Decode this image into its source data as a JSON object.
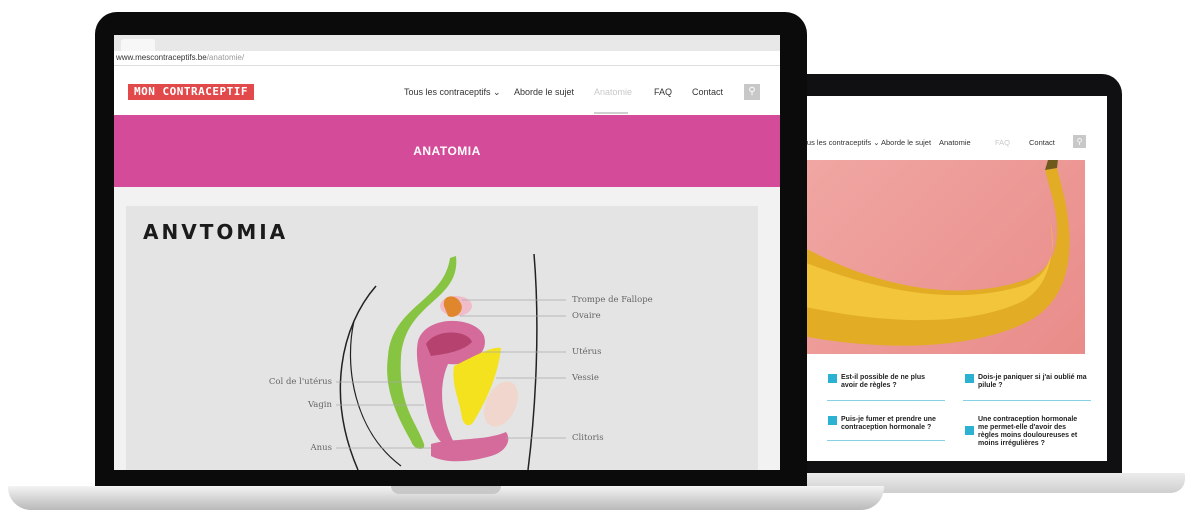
{
  "colors": {
    "logo_bg": "#e2494b",
    "banner_bg": "#d44b9a",
    "faq_check": "#2bb1d1",
    "banana_bg": "#f0a7a3"
  },
  "back_site": {
    "nav": [
      "Tous les contraceptifs ⌄",
      "Aborde le sujet",
      "Anatomie",
      "FAQ",
      "Contact"
    ],
    "search_icon": "search-icon",
    "faq": [
      "Est-il possible de ne plus avoir de règles ?",
      "Dois-je paniquer si j'ai oublié ma pilule ?",
      "Puis-je fumer et prendre une contraception hormonale ?",
      "Une contraception hormonale me permet-elle d'avoir des règles moins douloureuses et moins irrégulières ?"
    ]
  },
  "front_site": {
    "url_prefix": "www.mescontraceptifs.be",
    "url_path": "/anatomie/",
    "logo": "MON CONTRACEPTIF",
    "nav": [
      "Tous les contraceptifs ⌄",
      "Aborde le sujet",
      "Anatomie",
      "FAQ",
      "Contact"
    ],
    "active_nav": "Anatomie",
    "search_icon": "search-icon",
    "page_title": "ANATOMIA",
    "illustration": {
      "title": "ANVTOMIA",
      "labels_right": [
        "Trompe de Fallope",
        "Ovaire",
        "Utérus",
        "Vessie",
        "Clitoris"
      ],
      "labels_left": [
        "Col de l'utérus",
        "Vagin",
        "Anus"
      ]
    }
  }
}
